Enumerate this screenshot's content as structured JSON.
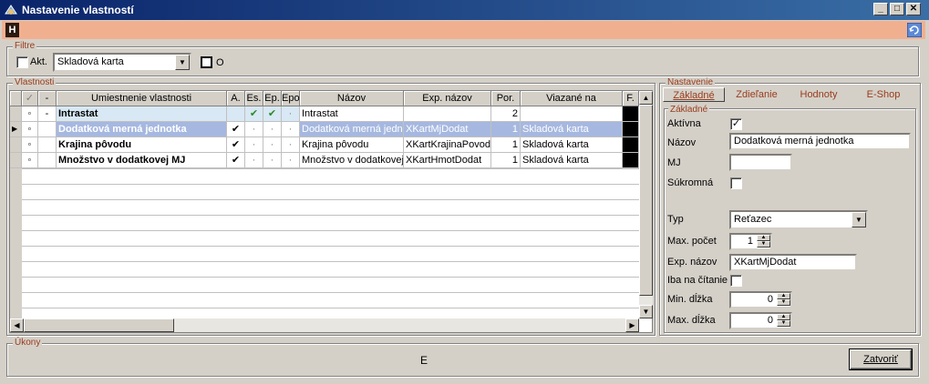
{
  "window": {
    "title": "Nastavenie vlastností",
    "minimize": "_",
    "maximize": "□",
    "close": "✕"
  },
  "toolbar": {
    "h_label": "H"
  },
  "filter": {
    "label": "Filtre",
    "akt_label": "Akt.",
    "combo_value": "Skladová karta",
    "o_label": "O"
  },
  "properties": {
    "label": "Vlastnosti",
    "columns": [
      "✓",
      "-",
      "Umiestnenie vlastnosti",
      "A.",
      "Es.",
      "Ep.",
      "Epo",
      "Názov",
      "Exp. názov",
      "Por.",
      "Viazané na",
      "F."
    ],
    "rows": [
      {
        "minus": "-",
        "location": "Intrastat",
        "a": "",
        "es": "✔",
        "ep": "✔",
        "epo": "·",
        "name": "Intrastat",
        "exp": "",
        "por": "2",
        "bound": ""
      },
      {
        "minus": "",
        "location": "Dodatková merná jednotka",
        "a": "✔",
        "es": "·",
        "ep": "·",
        "epo": "·",
        "name": "Dodatková merná jednotka",
        "exp": "XKartMjDodat",
        "por": "1",
        "bound": "Skladová karta"
      },
      {
        "minus": "",
        "location": "Krajina pôvodu",
        "a": "✔",
        "es": "·",
        "ep": "·",
        "epo": "·",
        "name": "Krajina pôvodu",
        "exp": "XKartKrajinaPovod",
        "por": "1",
        "bound": "Skladová karta"
      },
      {
        "minus": "",
        "location": "Množstvo v dodatkovej MJ",
        "a": "✔",
        "es": "·",
        "ep": "·",
        "epo": "·",
        "name": "Množstvo v dodatkovej",
        "exp": "XKartHmotDodat",
        "por": "1",
        "bound": "Skladová karta"
      }
    ]
  },
  "settings": {
    "label": "Nastavenie",
    "tabs": [
      "Základné",
      "Zdieľanie",
      "Hodnoty",
      "E-Shop"
    ],
    "section_label": "Základné",
    "aktivna_label": "Aktívna",
    "nazov_label": "Názov",
    "nazov_value": "Dodatková merná jednotka",
    "mj_label": "MJ",
    "mj_value": "",
    "sukromna_label": "Súkromná",
    "typ_label": "Typ",
    "typ_value": "Reťazec",
    "max_pocet_label": "Max. počet",
    "max_pocet_value": "1",
    "exp_nazov_label": "Exp. názov",
    "exp_nazov_value": "XKartMjDodat",
    "iba_label": "Iba na čítanie",
    "min_dlzka_label": "Min. dĺžka",
    "min_dlzka_value": "0",
    "max_dlzka_label": "Max. dĺžka",
    "max_dlzka_value": "0"
  },
  "actions": {
    "label": "Úkony",
    "center_text": "E",
    "close_button": "Zatvoriť"
  }
}
